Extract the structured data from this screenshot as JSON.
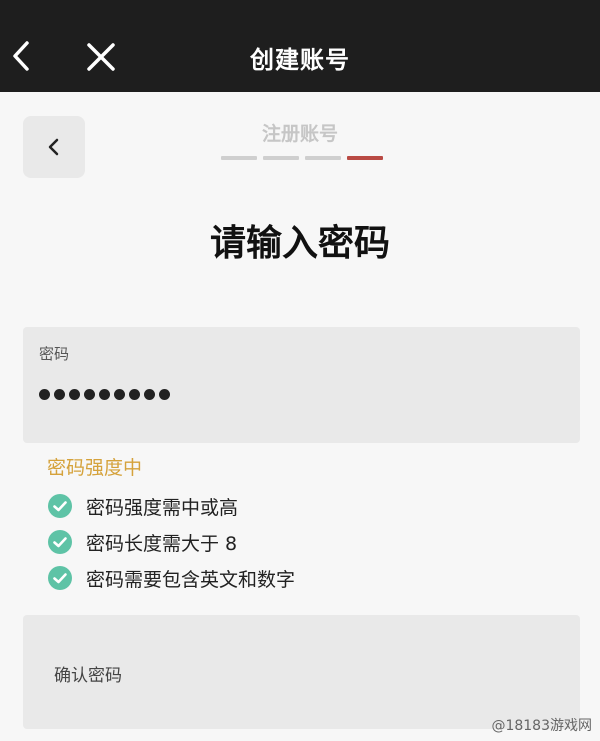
{
  "titlebar": {
    "title": "创建账号",
    "back_icon": "chevron-left-icon",
    "close_icon": "close-icon"
  },
  "step": {
    "title": "注册账号",
    "total": 4,
    "current": 4
  },
  "heading": "请输入密码",
  "password_field": {
    "label": "密码",
    "masked_length": 9
  },
  "strength": {
    "text": "密码强度中",
    "color": "#d5a23b"
  },
  "rules": [
    {
      "text": "密码强度需中或高",
      "met": true
    },
    {
      "text": "密码长度需大于 8",
      "met": true
    },
    {
      "text": "密码需要包含英文和数字",
      "met": true
    }
  ],
  "confirm_field": {
    "label": "确认密码"
  },
  "watermark": "@18183游戏网",
  "colors": {
    "titlebar_bg": "#1e1e1e",
    "accent_step": "#b94a44",
    "check_green": "#5ec3a6"
  }
}
